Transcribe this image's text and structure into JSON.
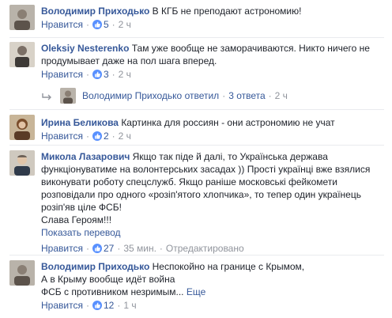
{
  "comments": [
    {
      "author": "Володимир Приходько",
      "text": "В КГБ не преподают астрономию!",
      "like_label": "Нравится",
      "likes": "5",
      "time": "2 ч"
    },
    {
      "author": "Oleksiy Nesterenko",
      "text": "Там уже вообще не заморачиваются. Никто ничего не продумывает даже на пол шага вперед.",
      "like_label": "Нравится",
      "likes": "3",
      "time": "2 ч",
      "replies": {
        "author": "Володимир Приходько",
        "verb": "ответил",
        "count": "3 ответа",
        "time": "2 ч"
      }
    },
    {
      "author": "Ирина Беликова",
      "text": "Картинка для россиян - они астрономию не учат",
      "like_label": "Нравится",
      "likes": "2",
      "time": "2 ч"
    },
    {
      "author": "Микола Лазарович",
      "text": "Якщо так піде й далі, то Українська держава функціонуватиме на волонтерських засадах )) Прості українці вже взялися виконувати роботу спецслужб. Якщо раніше московські фейкомети розповідали про одного «розіп'ятого хлопчика», то тепер один українець розіп'яв ціле ФСБ!",
      "text2": "Слава Героям!!!",
      "translate_label": "Показать перевод",
      "like_label": "Нравится",
      "likes": "27",
      "time": "35 мин.",
      "edited": "Отредактировано"
    },
    {
      "author": "Володимир Приходько",
      "text_line1": "Неспокойно на границе с Крымом,",
      "text_line2": "А в Крыму вообще идёт война",
      "text_line3": "ФСБ с противником незримым...",
      "more_label": "Еще",
      "like_label": "Нравится",
      "likes": "12",
      "time": "1 ч"
    }
  ],
  "icons": {
    "like": "like-thumb-icon",
    "reply_arrow": "reply-arrow-icon"
  },
  "colors": {
    "link": "#365899",
    "meta": "#90949c",
    "like_badge": "#5890ff"
  }
}
